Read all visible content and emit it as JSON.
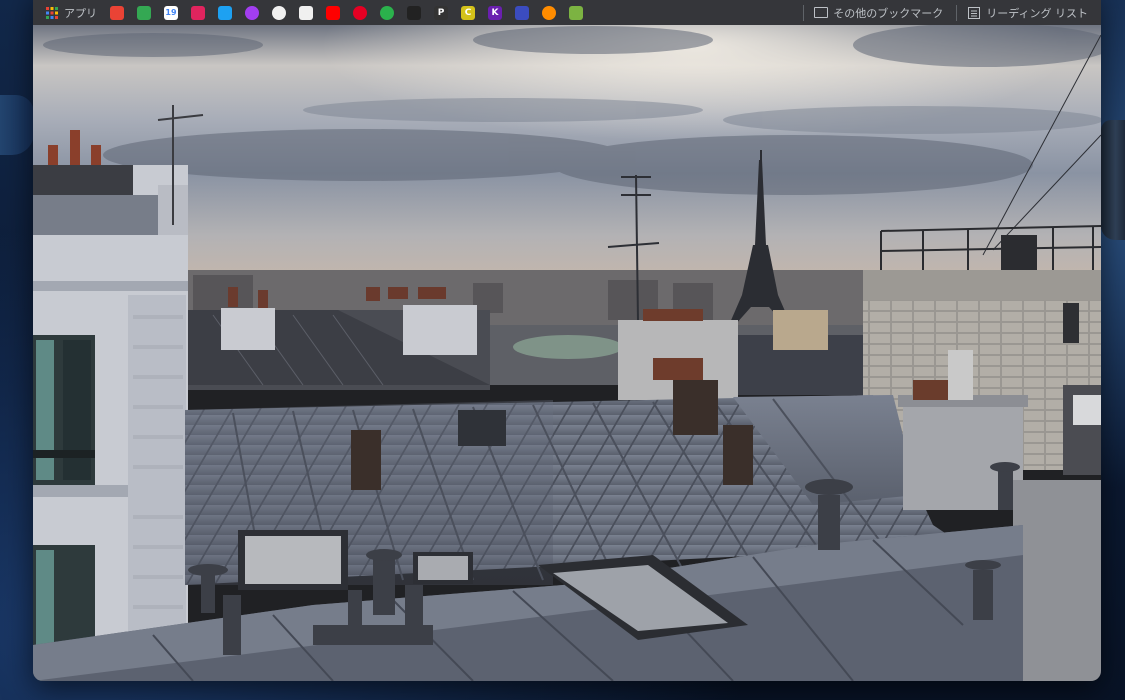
{
  "bookmarks_bar": {
    "apps_label": "アプリ",
    "items": [
      {
        "icon": "gmail-icon",
        "color": "#ea4335"
      },
      {
        "icon": "google-drive-icon",
        "color": "#34a853"
      },
      {
        "icon": "google-calendar-icon",
        "color": "#4285f4",
        "text": "19"
      },
      {
        "icon": "flower-app-icon",
        "color": "#e0245e"
      },
      {
        "icon": "twitter-icon",
        "color": "#1da1f2"
      },
      {
        "icon": "circle-app-icon",
        "color": "#a23ef0"
      },
      {
        "icon": "github-icon",
        "color": "#f0f0f0"
      },
      {
        "icon": "codepen-icon",
        "color": "#f0f0f0"
      },
      {
        "icon": "youtube-icon",
        "color": "#ff0000"
      },
      {
        "icon": "pinterest-icon",
        "color": "#e60023"
      },
      {
        "icon": "feedly-icon",
        "color": "#2bb24c"
      },
      {
        "icon": "diamond-app-icon",
        "color": "#222222"
      },
      {
        "icon": "p-app-icon",
        "color": "#333333",
        "text": "P"
      },
      {
        "icon": "c-app-icon",
        "color": "#d4c21a",
        "text": "C"
      },
      {
        "icon": "k-app-icon",
        "color": "#6a1fb0",
        "text": "K"
      },
      {
        "icon": "arrow-app-icon",
        "color": "#3b4cc0"
      },
      {
        "icon": "power-app-icon",
        "color": "#ff8c00"
      },
      {
        "icon": "triangle-app-icon",
        "color": "#7cb342"
      }
    ],
    "other_bookmarks_label": "その他のブックマーク",
    "reading_list_label": "リーディング リスト"
  },
  "page": {
    "image_subject": "Paris rooftops with the Eiffel Tower under an overcast sky"
  }
}
